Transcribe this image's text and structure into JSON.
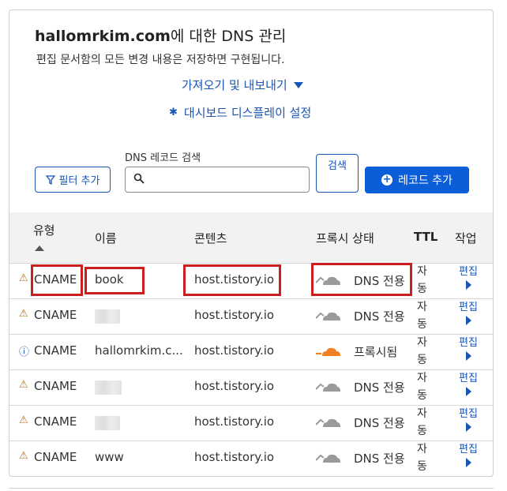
{
  "header": {
    "domain": "hallomrkim.com",
    "title_suffix": "에 대한 DNS 관리",
    "subtitle": "편집 문서함의 모든 변경 내용은 저장하면 구현됩니다."
  },
  "links": {
    "import_export": "가져오기 및 내보내기",
    "dashboard_settings": "대시보드 디스플레이 설정"
  },
  "toolbar": {
    "filter_label": "필터 추가",
    "search_label": "DNS 레코드 검색",
    "search_value": "",
    "search_button": "검색",
    "add_record": "레코드 추가"
  },
  "table": {
    "headers": {
      "type": "유형",
      "name": "이름",
      "content": "콘텐츠",
      "proxy": "프록시 상태",
      "ttl": "TTL",
      "action": "작업"
    },
    "rows": [
      {
        "status": "warning",
        "type": "CNAME",
        "name": "book",
        "content": "host.tistory.io",
        "proxy": "DNS 전용",
        "proxied": false,
        "ttl": "자동",
        "edit": "편집"
      },
      {
        "status": "warning",
        "type": "CNAME",
        "name": "",
        "content": "host.tistory.io",
        "proxy": "DNS 전용",
        "proxied": false,
        "ttl": "자동",
        "edit": "편집"
      },
      {
        "status": "info",
        "type": "CNAME",
        "name": "hallomrkim.c...",
        "content": "host.tistory.io",
        "proxy": "프록시됨",
        "proxied": true,
        "ttl": "자동",
        "edit": "편집"
      },
      {
        "status": "warning",
        "type": "CNAME",
        "name": "",
        "content": "host.tistory.io",
        "proxy": "DNS 전용",
        "proxied": false,
        "ttl": "자동",
        "edit": "편집"
      },
      {
        "status": "warning",
        "type": "CNAME",
        "name": "",
        "content": "host.tistory.io",
        "proxy": "DNS 전용",
        "proxied": false,
        "ttl": "자동",
        "edit": "편집"
      },
      {
        "status": "warning",
        "type": "CNAME",
        "name": "www",
        "content": "host.tistory.io",
        "proxy": "DNS 전용",
        "proxied": false,
        "ttl": "자동",
        "edit": "편집"
      }
    ]
  },
  "colors": {
    "accent": "#1a55b5",
    "primary_button": "#0b5ed7",
    "warning": "#b0731c",
    "proxied_cloud": "#f38020",
    "dns_cloud": "#9a9a9a",
    "highlight": "#cc1e1e"
  }
}
